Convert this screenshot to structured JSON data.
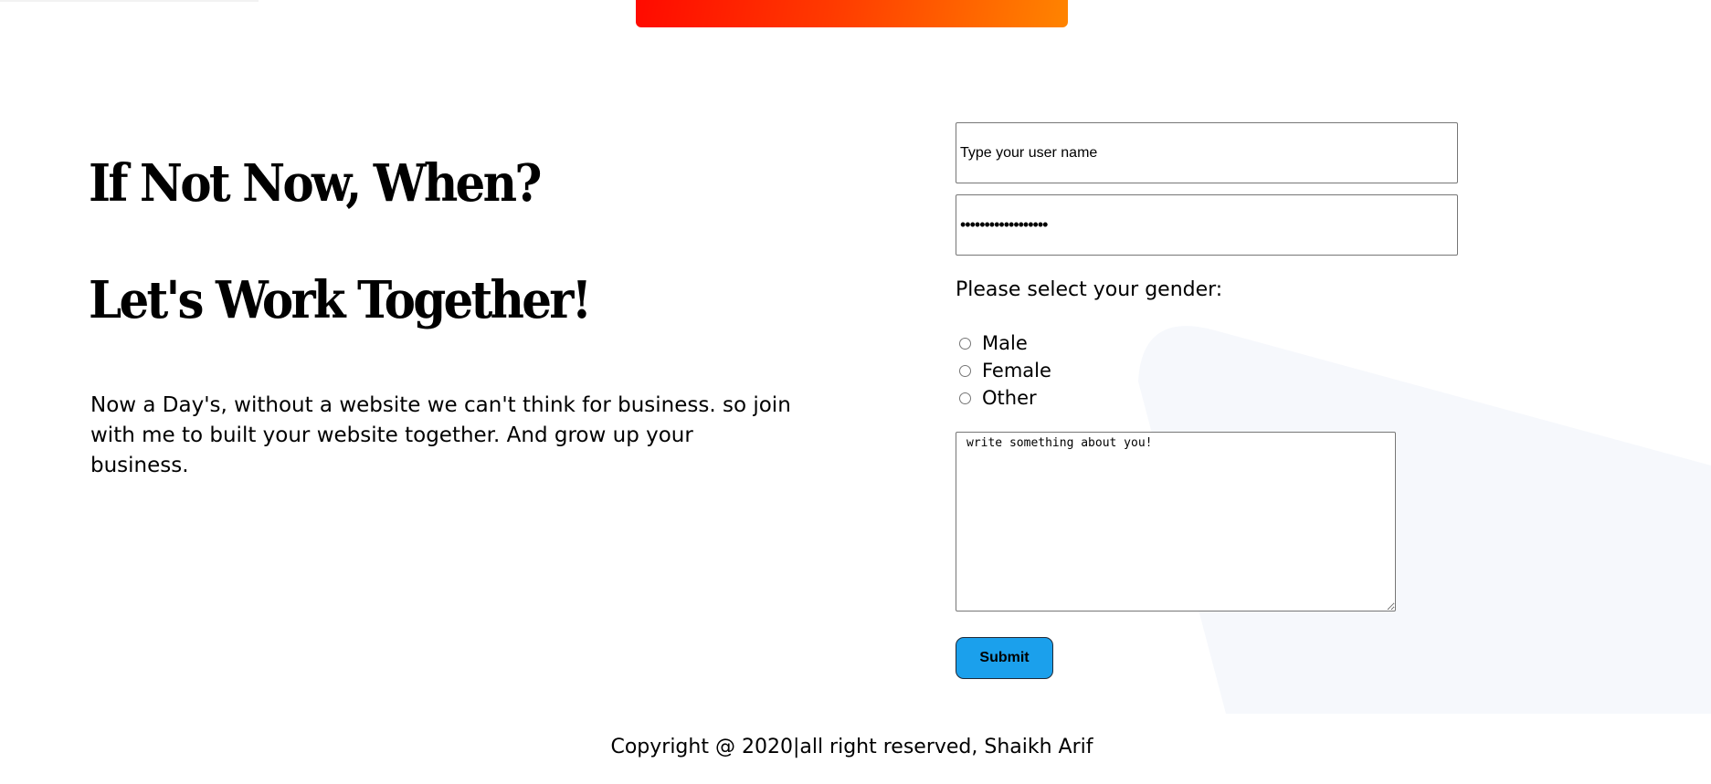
{
  "hero": {
    "headline_1": "If Not Now, When?",
    "headline_2": "Let's Work Together!",
    "intro": "Now a Day's, without a website we can't think for business. so join with me to built your website together. And grow up your business."
  },
  "form": {
    "username_placeholder": "Type your user name",
    "password_value": "••••••••••••••••••",
    "gender_question": "Please select your gender:",
    "gender_options": [
      "Male",
      "Female",
      "Other"
    ],
    "about_placeholder": "write something about you!",
    "submit_label": "Submit"
  },
  "footer": {
    "copyright": "Copyright @ 2020|all right reserved, Shaikh Arif"
  },
  "colors": {
    "top_bar_start": "#ff0a00",
    "top_bar_end": "#ff8400",
    "submit_bg": "#1ba0ec",
    "bg_shape": "#f6f8fc"
  }
}
